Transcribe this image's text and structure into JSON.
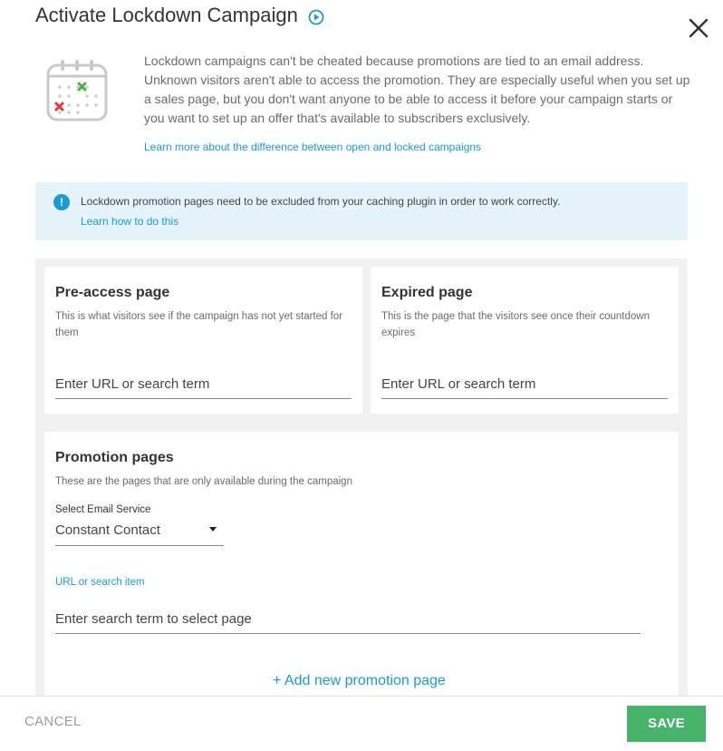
{
  "dialog": {
    "title": "Activate Lockdown Campaign",
    "intro_text": "Lockdown campaigns can't be cheated because promotions are tied to an email address. Unknown visitors aren't able to access the promotion. They are especially useful when you set up a sales page, but you don't want anyone to be able to access it before your campaign starts or you want to set up an offer that's available to subscribers exclusively.",
    "learn_more_link": "Learn more about the difference between open and locked campaigns"
  },
  "notice": {
    "icon": "!",
    "text": "Lockdown promotion pages need to be excluded from your caching plugin in order to work correctly.",
    "link": "Learn how to do this"
  },
  "pre_access": {
    "title": "Pre-access page",
    "description": "This is what visitors see if the campaign has not yet started for them",
    "input_placeholder": "Enter URL or search term"
  },
  "expired": {
    "title": "Expired page",
    "description": "This is the page that the visitors see once their countdown expires",
    "input_placeholder": "Enter URL or search term"
  },
  "promotion": {
    "title": "Promotion pages",
    "description": "These are the pages that are only available during the campaign",
    "email_service_label": "Select Email Service",
    "email_service_value": "Constant Contact",
    "url_label": "URL or search item",
    "search_placeholder": "Enter search term to select page",
    "add_link": "+ Add new promotion page"
  },
  "footer": {
    "cancel_label": "CANCEL",
    "save_label": "SAVE"
  },
  "colors": {
    "accent": "#1b9ad6",
    "save": "#47b36b",
    "notice_bg": "#e5f3fb",
    "panel_bg": "#f1f1f1"
  },
  "icons": [
    "play-circle-icon",
    "close-icon",
    "calendar-icon",
    "info-icon",
    "dropdown-caret-icon"
  ]
}
